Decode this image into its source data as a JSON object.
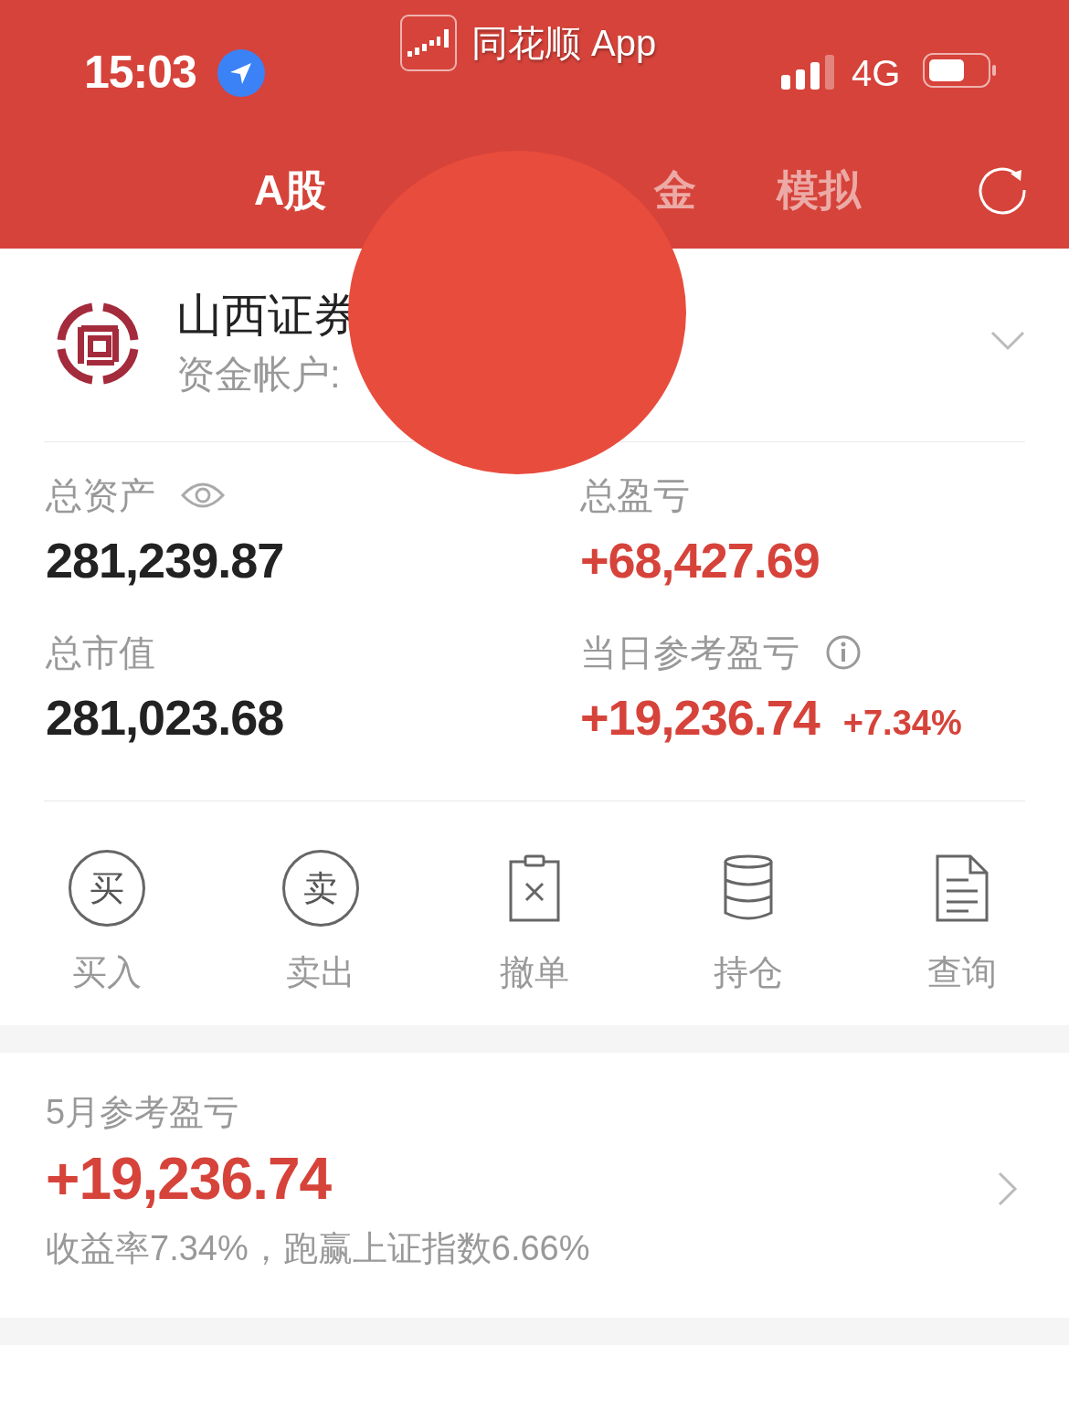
{
  "status_bar": {
    "time": "15:03",
    "app_name": "同花顺 App",
    "network": "4G"
  },
  "tabs": [
    {
      "label": "A股",
      "selected": true
    },
    {
      "label": "金",
      "selected": false
    },
    {
      "label": "模拟",
      "selected": false
    }
  ],
  "account": {
    "broker": "山西证券",
    "account_label": "资金帐户:"
  },
  "assets": [
    {
      "label": "总资产",
      "value": "281,239.87",
      "kind": "eye",
      "positive": false
    },
    {
      "label": "总盈亏",
      "value": "+68,427.69",
      "kind": "plain",
      "positive": true
    },
    {
      "label": "总市值",
      "value": "281,023.68",
      "kind": "plain",
      "positive": false
    },
    {
      "label": "当日参考盈亏",
      "value": "+19,236.74",
      "change": "+7.34%",
      "kind": "info",
      "positive": true
    }
  ],
  "actions": [
    {
      "glyph": "买",
      "label": "买入",
      "kind": "circle"
    },
    {
      "glyph": "卖",
      "label": "卖出",
      "kind": "circle"
    },
    {
      "label": "撤单",
      "kind": "cancel"
    },
    {
      "label": "持仓",
      "kind": "stack"
    },
    {
      "label": "查询",
      "kind": "doc"
    }
  ],
  "monthly": {
    "title": "5月参考盈亏",
    "value": "+19,236.74",
    "summary": "收益率7.34%，跑赢上证指数6.66%"
  }
}
